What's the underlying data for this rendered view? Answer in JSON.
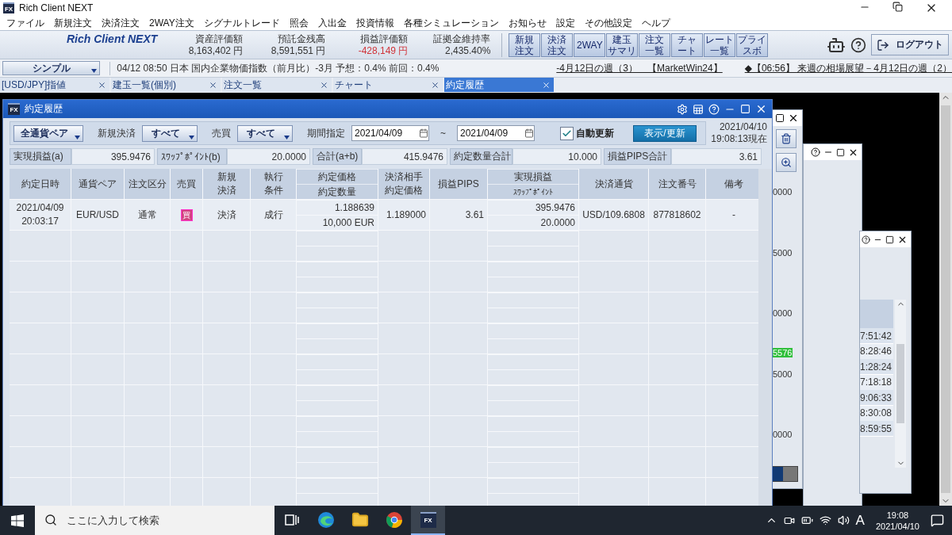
{
  "app": {
    "badge": "FX",
    "title": "Rich Client NEXT"
  },
  "menu": [
    "ファイル",
    "新規注文",
    "決済注文",
    "2WAY注文",
    "シグナルトレード",
    "照会",
    "入出金",
    "投資情報",
    "各種シミュレーション",
    "お知らせ",
    "設定",
    "その他設定",
    "ヘルプ"
  ],
  "header": {
    "logo": "Rich Client NEXT",
    "metrics": [
      {
        "label": "資産評価額",
        "value": "8,163,402 円",
        "negative": false
      },
      {
        "label": "預託金残高",
        "value": "8,591,551 円",
        "negative": false
      },
      {
        "label": "損益評価額",
        "value": "-428,149 円",
        "negative": true
      },
      {
        "label": "証拠金維持率",
        "value": "2,435.40%",
        "negative": false
      }
    ],
    "toolbar": [
      {
        "lines": [
          "新規",
          "注文"
        ]
      },
      {
        "lines": [
          "決済",
          "注文"
        ]
      },
      {
        "lines": [
          "2WAY"
        ]
      },
      {
        "lines": [
          "建玉",
          "サマリ"
        ]
      },
      {
        "lines": [
          "注文",
          "一覧"
        ]
      },
      {
        "lines": [
          "チャ",
          "ート"
        ]
      },
      {
        "lines": [
          "レート",
          "一覧"
        ]
      },
      {
        "lines": [
          "プライ",
          "スボ"
        ]
      }
    ],
    "logout": "ログアウト"
  },
  "ticker": {
    "mode": "シンプル",
    "news": "04/12 08:50 日本 国内企業物価指数（前月比）-3月 予想：0.4% 前回：0.4%",
    "links": [
      "-4月12日の週（3）　【MarketWin24】",
      "◆【06:56】 来週の相場展望－4月12日の週（2）"
    ]
  },
  "tabs": [
    {
      "label": "[USD/JPY]指値",
      "selected": false
    },
    {
      "label": "建玉一覧(個別)",
      "selected": false
    },
    {
      "label": "注文一覧",
      "selected": false
    },
    {
      "label": "チャート",
      "selected": false
    },
    {
      "label": "約定履歴",
      "selected": true
    }
  ],
  "history": {
    "badge": "FX",
    "title": "約定履歴",
    "currency": "全通貨ペア",
    "filters": [
      {
        "label": "新規決済",
        "value": "すべて"
      },
      {
        "label": "売買",
        "value": "すべて"
      }
    ],
    "period": {
      "label": "期間指定",
      "from": "2021/04/09",
      "separator": "~",
      "to": "2021/04/09"
    },
    "auto_refresh": {
      "label": "自動更新",
      "checked": true
    },
    "refresh_button": "表示/更新",
    "as_of": [
      "2021/04/10",
      "19:08:13現在"
    ],
    "summary": [
      {
        "label": "実現損益(a)",
        "value": "395.9476"
      },
      {
        "label": "ｽﾜｯﾌﾟﾎﾟｲﾝﾄ(b)",
        "value": "20.0000"
      },
      {
        "label": "合計(a+b)",
        "value": "415.9476"
      },
      {
        "label": "約定数量合計",
        "value": "10.000"
      },
      {
        "label": "損益PIPS合計",
        "value": "3.61"
      }
    ],
    "columns": [
      {
        "kind": "plain",
        "lines": [
          "約定日時"
        ]
      },
      {
        "kind": "plain",
        "lines": [
          "通貨ペア"
        ]
      },
      {
        "kind": "plain",
        "lines": [
          "注文区分"
        ]
      },
      {
        "kind": "plain",
        "lines": [
          "売買"
        ]
      },
      {
        "kind": "plain",
        "lines": [
          "新規",
          "決済"
        ]
      },
      {
        "kind": "plain",
        "lines": [
          "執行",
          "条件"
        ]
      },
      {
        "kind": "split",
        "lines": [
          "約定価格",
          "約定数量"
        ]
      },
      {
        "kind": "plain",
        "lines": [
          "決済相手",
          "約定価格"
        ]
      },
      {
        "kind": "plain",
        "lines": [
          "損益PIPS"
        ]
      },
      {
        "kind": "split",
        "lines": [
          "実現損益",
          "ｽﾜｯﾌﾟﾎﾟｲﾝﾄ"
        ]
      },
      {
        "kind": "plain",
        "lines": [
          "決済通貨"
        ]
      },
      {
        "kind": "plain",
        "lines": [
          "注文番号"
        ]
      },
      {
        "kind": "plain",
        "lines": [
          "備考"
        ]
      }
    ],
    "rows": [
      {
        "cells": [
          {
            "kind": "text",
            "lines": [
              "2021/04/09",
              "20:03:17"
            ]
          },
          {
            "kind": "text",
            "lines": [
              "EUR/USD"
            ]
          },
          {
            "kind": "text",
            "lines": [
              "通常"
            ]
          },
          {
            "kind": "badge",
            "lines": [
              "買"
            ]
          },
          {
            "kind": "text",
            "lines": [
              "決済"
            ]
          },
          {
            "kind": "text",
            "lines": [
              "成行"
            ]
          },
          {
            "kind": "split",
            "lines": [
              "1.188639",
              "10,000 EUR"
            ]
          },
          {
            "kind": "number",
            "lines": [
              "1.189000"
            ]
          },
          {
            "kind": "number",
            "lines": [
              "3.61"
            ]
          },
          {
            "kind": "split",
            "lines": [
              "395.9476",
              "20.0000"
            ]
          },
          {
            "kind": "text",
            "lines": [
              "USD/109.6808"
            ]
          },
          {
            "kind": "text",
            "lines": [
              "877818602"
            ]
          },
          {
            "kind": "text",
            "lines": [
              "-"
            ]
          }
        ]
      }
    ]
  },
  "chart_window": {
    "labels": [
      {
        "kind": "axis",
        "text": "0000"
      },
      {
        "kind": "axis",
        "text": "5000"
      },
      {
        "kind": "axis",
        "text": "0000"
      },
      {
        "kind": "price",
        "text": "5576"
      },
      {
        "kind": "axis",
        "text": "5000"
      },
      {
        "kind": "axis",
        "text": "0000"
      }
    ]
  },
  "list_window": {
    "times": [
      "7:51:42",
      "8:28:46",
      "1:28:24",
      "7:18:18",
      "9:06:33",
      "8:30:08",
      "8:59:55"
    ]
  },
  "taskbar": {
    "search_placeholder": "ここに入力して検索",
    "app_badge": "FX",
    "ime": "A",
    "time": "19:08",
    "date": "2021/04/10"
  }
}
